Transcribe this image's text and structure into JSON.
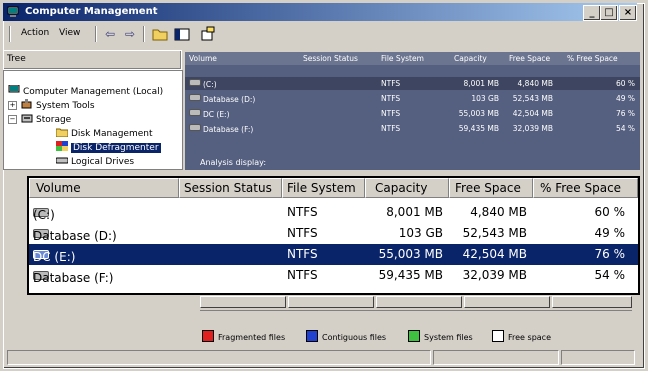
{
  "window": {
    "title": "Computer Management",
    "minimize": "_",
    "maximize": "□",
    "close": "×"
  },
  "menu": {
    "action": "Action",
    "view": "View",
    "back": "⇦",
    "forward": "⇨"
  },
  "tree": {
    "tab": "Tree",
    "root": "Computer Management (Local)",
    "system_tools": "System Tools",
    "storage": "Storage",
    "disk_management": "Disk Management",
    "disk_defragmenter": "Disk Defragmenter",
    "logical_drives": "Logical Drives"
  },
  "background_table": {
    "headers": [
      "Volume",
      "Session Status",
      "File System",
      "Capacity",
      "Free Space",
      "% Free Space"
    ],
    "rows": [
      {
        "volume": "(C:)",
        "status": "",
        "fs": "NTFS",
        "capacity": "8,001 MB",
        "free": "4,840 MB",
        "pct": "60 %"
      },
      {
        "volume": "Database (D:)",
        "status": "",
        "fs": "NTFS",
        "capacity": "103 GB",
        "free": "52,543 MB",
        "pct": "49 %"
      },
      {
        "volume": "DC (E:)",
        "status": "",
        "fs": "NTFS",
        "capacity": "55,003 MB",
        "free": "42,504 MB",
        "pct": "76 %"
      },
      {
        "volume": "Database (F:)",
        "status": "",
        "fs": "NTFS",
        "capacity": "59,435 MB",
        "free": "32,039 MB",
        "pct": "54 %"
      }
    ],
    "analysis_label": "Analysis display:"
  },
  "zoom_table": {
    "headers": [
      "Volume",
      "Session Status",
      "File System",
      "Capacity",
      "Free Space",
      "% Free Space"
    ],
    "rows": [
      {
        "volume": "(C:)",
        "status": "",
        "fs": "NTFS",
        "capacity": "8,001 MB",
        "free": "4,840 MB",
        "pct": "60 %"
      },
      {
        "volume": "Database (D:)",
        "status": "",
        "fs": "NTFS",
        "capacity": "103 GB",
        "free": "52,543 MB",
        "pct": "49 %"
      },
      {
        "volume": "DC (E:)",
        "status": "",
        "fs": "NTFS",
        "capacity": "55,003 MB",
        "free": "42,504 MB",
        "pct": "76 %"
      },
      {
        "volume": "Database (F:)",
        "status": "",
        "fs": "NTFS",
        "capacity": "59,435 MB",
        "free": "32,039 MB",
        "pct": "54 %"
      }
    ],
    "selected_row": 2
  },
  "legend": {
    "fragmented": "Fragmented files",
    "contiguous": "Contiguous files",
    "system": "System files",
    "free": "Free space",
    "colors": {
      "fragmented": "#e02020",
      "contiguous": "#2040d0",
      "system": "#40c040",
      "free": "#ffffff"
    }
  }
}
